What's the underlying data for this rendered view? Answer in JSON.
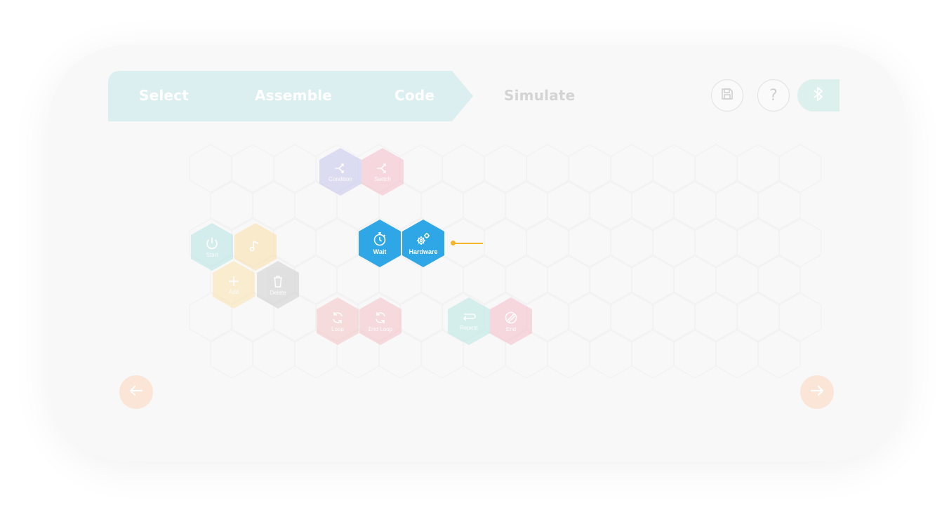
{
  "steps": {
    "select": "Select",
    "assemble": "Assemble",
    "code": "Code",
    "simulate": "Simulate"
  },
  "toolbar": {
    "save_icon": "save-icon",
    "help_icon": "help-icon",
    "help_glyph": "?",
    "bluetooth_icon": "bluetooth-icon"
  },
  "blocks": {
    "condition": "Condition",
    "switch": "Switch",
    "start": "Start",
    "sound": "",
    "add": "Add",
    "delete": "Delete",
    "wait": "Wait",
    "hardware": "Hardware",
    "loop": "Loop",
    "end_loop": "End Loop",
    "repeat": "Repeat",
    "end": "End"
  },
  "colors": {
    "stepbar": "#dceff0",
    "active_block": "#2fa6e6",
    "active_block_border": "#1b8fd4",
    "condition_block": "#d9d9f1",
    "switch_block": "#f8d6dc",
    "start_block": "#cfeeed",
    "sound_block": "#fbedc8",
    "add_block": "#fbefcd",
    "delete_block": "#dcdcdc",
    "loop_block": "#f8dcdc",
    "repeat_block": "#cfeeed",
    "end_block": "#f8d6dc",
    "connector": "#f6b62a",
    "nav_arrow": "#fbe5d6"
  },
  "nav": {
    "prev_icon": "arrow-left-icon",
    "next_icon": "arrow-right-icon"
  }
}
